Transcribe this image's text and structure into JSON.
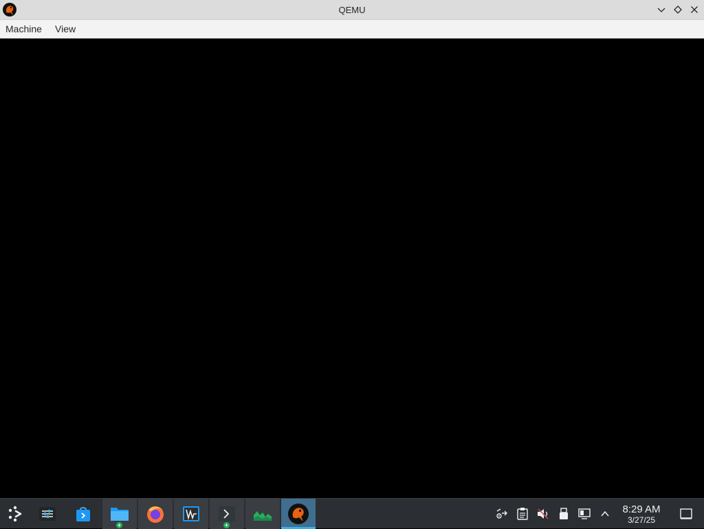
{
  "window": {
    "title": "QEMU",
    "app_icon": "qemu-icon",
    "controls": [
      "chevron-down-icon",
      "diamond-icon",
      "close-icon"
    ]
  },
  "menubar": {
    "items": [
      {
        "label": "Machine"
      },
      {
        "label": "View"
      }
    ]
  },
  "taskbar": {
    "launcher_icon": "app-launcher-icon",
    "apps": [
      {
        "name": "system-settings-icon",
        "state": "normal"
      },
      {
        "name": "discover-store-icon",
        "state": "normal"
      },
      {
        "name": "file-manager-icon",
        "state": "running"
      },
      {
        "name": "firefox-icon",
        "state": "running"
      },
      {
        "name": "virt-manager-icon",
        "state": "running"
      },
      {
        "name": "terminal-icon",
        "state": "running"
      },
      {
        "name": "system-monitor-icon",
        "state": "running"
      },
      {
        "name": "qemu-icon",
        "state": "active"
      }
    ],
    "tray": [
      "network-icon",
      "clipboard-icon",
      "volume-muted-icon",
      "usb-icon",
      "display-icon",
      "chevron-up-icon"
    ],
    "clock": {
      "time": "8:29 AM",
      "date": "3/27/25"
    },
    "show_desktop_icon": "show-desktop-icon"
  },
  "colors": {
    "titlebar": "#dcdcdc",
    "menubar": "#f3f3f3",
    "screen": "#000000",
    "taskbar": "#2b2e32",
    "accent": "#3daee9"
  }
}
